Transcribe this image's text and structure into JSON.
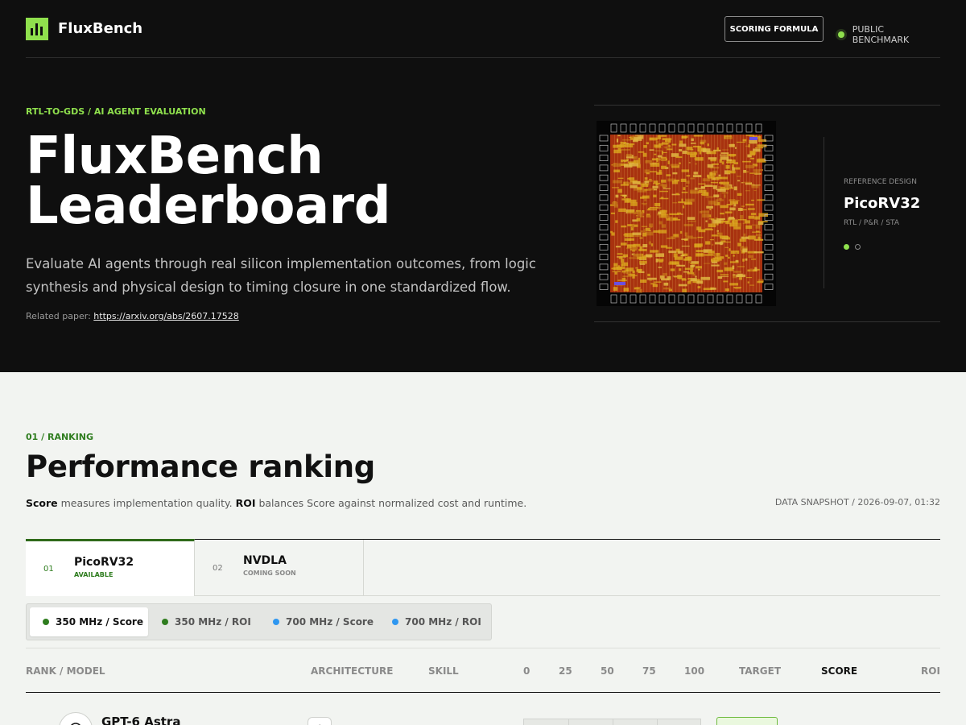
{
  "colors": {
    "accent": "#8fe04d",
    "dark_green": "#2f7d1f",
    "blue": "#2f97f0",
    "hero_bg": "#0f0f0f",
    "page_bg": "#f2f4f1"
  },
  "header": {
    "brand": "FluxBench",
    "scoring_formula_button": "SCORING FORMULA",
    "public_label": "PUBLIC BENCHMARK",
    "logo_icon": "bar-chart-icon"
  },
  "hero": {
    "kicker": "RTL-TO-GDS / AI AGENT EVALUATION",
    "title_line1": "FluxBench",
    "title_line2": "Leaderboard",
    "description": "Evaluate AI agents through real silicon implementation outcomes, from logic synthesis and physical design to timing closure in one standardized flow.",
    "paper_label": "Related paper:",
    "paper_link": "https://arxiv.org/abs/2607.17528"
  },
  "reference": {
    "kicker": "REFERENCE DESIGN",
    "name": "PicoRV32",
    "sub": "RTL / P&R / STA",
    "carousel_active": 1,
    "carousel_total": 2
  },
  "ranking": {
    "kicker": "01 / RANKING",
    "title": "Performance ranking",
    "desc_score_term": "Score",
    "desc_part1": " measures implementation quality. ",
    "desc_roi_term": "ROI",
    "desc_part2": " balances Score against normalized cost and runtime.",
    "snapshot": "DATA SNAPSHOT / 2026-09-07, 01:32"
  },
  "design_tabs": [
    {
      "num": "01",
      "name": "PicoRV32",
      "status": "AVAILABLE"
    },
    {
      "num": "02",
      "name": "NVDLA",
      "status": "COMING SOON"
    }
  ],
  "metric_tabs": [
    {
      "label": "350 MHz / Score",
      "dot": "#2f7d1f"
    },
    {
      "label": "350 MHz / ROI",
      "dot": "#2f7d1f"
    },
    {
      "label": "700 MHz / Score",
      "dot": "#2f97f0"
    },
    {
      "label": "700 MHz / ROI",
      "dot": "#2f97f0"
    }
  ],
  "table_headers": {
    "rank_model": "RANK / MODEL",
    "architecture": "ARCHITECTURE",
    "skill": "SKILL",
    "scale": [
      "0",
      "25",
      "50",
      "75",
      "100"
    ],
    "target": "TARGET",
    "score": "SCORE",
    "roi": "ROI"
  },
  "rows": [
    {
      "model": "GPT-6 Astra",
      "logo_icon": "openai-logo-icon",
      "arch_icon": "cloud-icon"
    }
  ]
}
